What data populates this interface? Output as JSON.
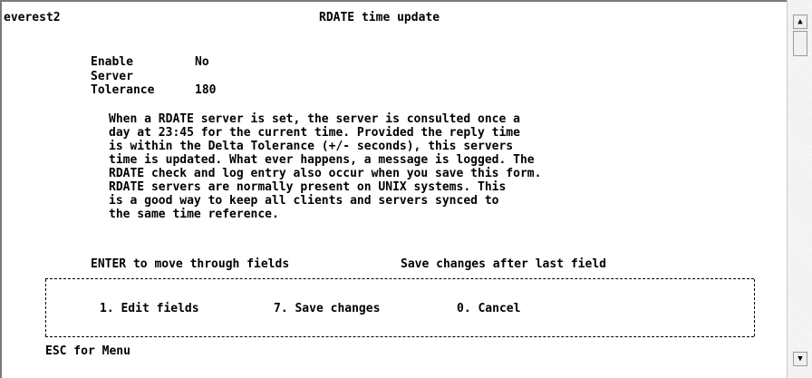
{
  "header": {
    "host": "everest2",
    "title": "RDATE time update"
  },
  "fields": [
    {
      "label": "Enable",
      "value": "No"
    },
    {
      "label": "Server",
      "value": ""
    },
    {
      "label": "Tolerance",
      "value": "180"
    }
  ],
  "description": [
    "When a RDATE server is set, the server is consulted once a",
    "day at 23:45 for the current time. Provided the reply time",
    "is within the Delta Tolerance (+/- seconds), this servers",
    "time is updated. What ever happens, a message is logged. The",
    "RDATE check and log entry also occur when you save this form.",
    "RDATE servers are normally present on UNIX systems. This",
    "is a good way to keep all clients and servers synced to",
    "the same time reference."
  ],
  "instructions": {
    "left": "ENTER to move through fields",
    "right": "Save changes after last field"
  },
  "menu": {
    "edit": "1. Edit fields",
    "save": "7. Save changes",
    "cancel": "0. Cancel"
  },
  "footer": {
    "esc": "ESC for Menu"
  },
  "scrollbar": {
    "up": "▲",
    "down": "▼"
  }
}
